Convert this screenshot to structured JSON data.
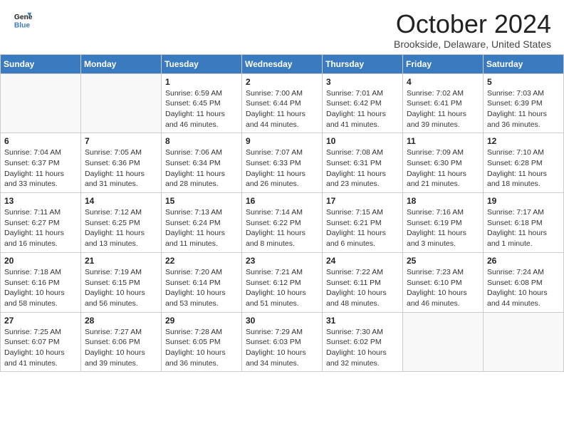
{
  "header": {
    "logo_line1": "General",
    "logo_line2": "Blue",
    "month_title": "October 2024",
    "subtitle": "Brookside, Delaware, United States"
  },
  "days_of_week": [
    "Sunday",
    "Monday",
    "Tuesday",
    "Wednesday",
    "Thursday",
    "Friday",
    "Saturday"
  ],
  "weeks": [
    [
      {
        "day": "",
        "info": ""
      },
      {
        "day": "",
        "info": ""
      },
      {
        "day": "1",
        "info": "Sunrise: 6:59 AM\nSunset: 6:45 PM\nDaylight: 11 hours and 46 minutes."
      },
      {
        "day": "2",
        "info": "Sunrise: 7:00 AM\nSunset: 6:44 PM\nDaylight: 11 hours and 44 minutes."
      },
      {
        "day": "3",
        "info": "Sunrise: 7:01 AM\nSunset: 6:42 PM\nDaylight: 11 hours and 41 minutes."
      },
      {
        "day": "4",
        "info": "Sunrise: 7:02 AM\nSunset: 6:41 PM\nDaylight: 11 hours and 39 minutes."
      },
      {
        "day": "5",
        "info": "Sunrise: 7:03 AM\nSunset: 6:39 PM\nDaylight: 11 hours and 36 minutes."
      }
    ],
    [
      {
        "day": "6",
        "info": "Sunrise: 7:04 AM\nSunset: 6:37 PM\nDaylight: 11 hours and 33 minutes."
      },
      {
        "day": "7",
        "info": "Sunrise: 7:05 AM\nSunset: 6:36 PM\nDaylight: 11 hours and 31 minutes."
      },
      {
        "day": "8",
        "info": "Sunrise: 7:06 AM\nSunset: 6:34 PM\nDaylight: 11 hours and 28 minutes."
      },
      {
        "day": "9",
        "info": "Sunrise: 7:07 AM\nSunset: 6:33 PM\nDaylight: 11 hours and 26 minutes."
      },
      {
        "day": "10",
        "info": "Sunrise: 7:08 AM\nSunset: 6:31 PM\nDaylight: 11 hours and 23 minutes."
      },
      {
        "day": "11",
        "info": "Sunrise: 7:09 AM\nSunset: 6:30 PM\nDaylight: 11 hours and 21 minutes."
      },
      {
        "day": "12",
        "info": "Sunrise: 7:10 AM\nSunset: 6:28 PM\nDaylight: 11 hours and 18 minutes."
      }
    ],
    [
      {
        "day": "13",
        "info": "Sunrise: 7:11 AM\nSunset: 6:27 PM\nDaylight: 11 hours and 16 minutes."
      },
      {
        "day": "14",
        "info": "Sunrise: 7:12 AM\nSunset: 6:25 PM\nDaylight: 11 hours and 13 minutes."
      },
      {
        "day": "15",
        "info": "Sunrise: 7:13 AM\nSunset: 6:24 PM\nDaylight: 11 hours and 11 minutes."
      },
      {
        "day": "16",
        "info": "Sunrise: 7:14 AM\nSunset: 6:22 PM\nDaylight: 11 hours and 8 minutes."
      },
      {
        "day": "17",
        "info": "Sunrise: 7:15 AM\nSunset: 6:21 PM\nDaylight: 11 hours and 6 minutes."
      },
      {
        "day": "18",
        "info": "Sunrise: 7:16 AM\nSunset: 6:19 PM\nDaylight: 11 hours and 3 minutes."
      },
      {
        "day": "19",
        "info": "Sunrise: 7:17 AM\nSunset: 6:18 PM\nDaylight: 11 hours and 1 minute."
      }
    ],
    [
      {
        "day": "20",
        "info": "Sunrise: 7:18 AM\nSunset: 6:16 PM\nDaylight: 10 hours and 58 minutes."
      },
      {
        "day": "21",
        "info": "Sunrise: 7:19 AM\nSunset: 6:15 PM\nDaylight: 10 hours and 56 minutes."
      },
      {
        "day": "22",
        "info": "Sunrise: 7:20 AM\nSunset: 6:14 PM\nDaylight: 10 hours and 53 minutes."
      },
      {
        "day": "23",
        "info": "Sunrise: 7:21 AM\nSunset: 6:12 PM\nDaylight: 10 hours and 51 minutes."
      },
      {
        "day": "24",
        "info": "Sunrise: 7:22 AM\nSunset: 6:11 PM\nDaylight: 10 hours and 48 minutes."
      },
      {
        "day": "25",
        "info": "Sunrise: 7:23 AM\nSunset: 6:10 PM\nDaylight: 10 hours and 46 minutes."
      },
      {
        "day": "26",
        "info": "Sunrise: 7:24 AM\nSunset: 6:08 PM\nDaylight: 10 hours and 44 minutes."
      }
    ],
    [
      {
        "day": "27",
        "info": "Sunrise: 7:25 AM\nSunset: 6:07 PM\nDaylight: 10 hours and 41 minutes."
      },
      {
        "day": "28",
        "info": "Sunrise: 7:27 AM\nSunset: 6:06 PM\nDaylight: 10 hours and 39 minutes."
      },
      {
        "day": "29",
        "info": "Sunrise: 7:28 AM\nSunset: 6:05 PM\nDaylight: 10 hours and 36 minutes."
      },
      {
        "day": "30",
        "info": "Sunrise: 7:29 AM\nSunset: 6:03 PM\nDaylight: 10 hours and 34 minutes."
      },
      {
        "day": "31",
        "info": "Sunrise: 7:30 AM\nSunset: 6:02 PM\nDaylight: 10 hours and 32 minutes."
      },
      {
        "day": "",
        "info": ""
      },
      {
        "day": "",
        "info": ""
      }
    ]
  ]
}
